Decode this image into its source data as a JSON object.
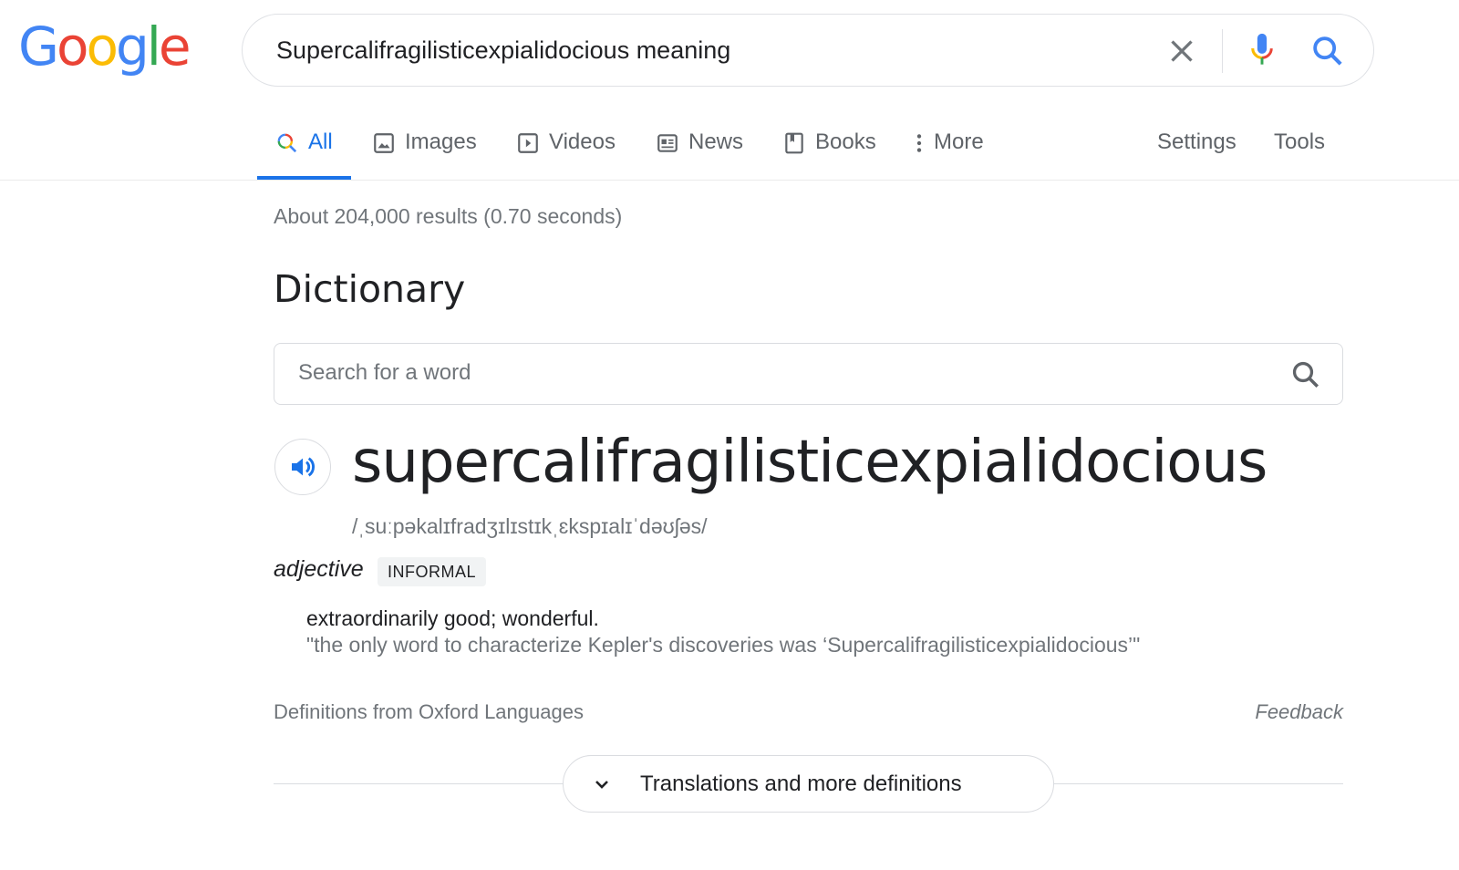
{
  "header": {
    "logo": {
      "letters": [
        "G",
        "o",
        "o",
        "g",
        "l",
        "e"
      ],
      "colors": [
        "#4285f4",
        "#ea4335",
        "#fbbc05",
        "#4285f4",
        "#34a853",
        "#ea4335"
      ]
    },
    "search_query": "Supercalifragilisticexpialidocious meaning",
    "icons": {
      "clear": "close-icon",
      "voice": "microphone-icon",
      "search": "search-icon"
    }
  },
  "tabs": [
    {
      "label": "All",
      "icon": "search-icon",
      "active": true
    },
    {
      "label": "Images",
      "icon": "image-icon",
      "active": false
    },
    {
      "label": "Videos",
      "icon": "play-icon",
      "active": false
    },
    {
      "label": "News",
      "icon": "newspaper-icon",
      "active": false
    },
    {
      "label": "Books",
      "icon": "book-icon",
      "active": false
    },
    {
      "label": "More",
      "icon": "more-vert-icon",
      "active": false
    }
  ],
  "tools": {
    "settings_label": "Settings",
    "tools_label": "Tools"
  },
  "result_stats": "About 204,000 results (0.70 seconds)",
  "dictionary": {
    "heading": "Dictionary",
    "search_placeholder": "Search for a word",
    "headword": "supercalifragilisticexpialidocious",
    "phonetic": "/ˌsuːpəkalɪfradʒɪlɪstɪkˌɛkspɪalɪˈdəʊʃəs/",
    "part_of_speech": "adjective",
    "register_label": "INFORMAL",
    "definition": "extraordinarily good; wonderful.",
    "example": "\"the only word to characterize Kepler's discoveries was ‘Supercalifragilisticexpialidocious’\"",
    "source": "Definitions from Oxford Languages",
    "feedback_label": "Feedback",
    "more_button_label": "Translations and more definitions"
  },
  "colors": {
    "accent": "#1a73e8",
    "text_primary": "#202124",
    "text_secondary": "#70757a",
    "border": "#dadce0"
  }
}
